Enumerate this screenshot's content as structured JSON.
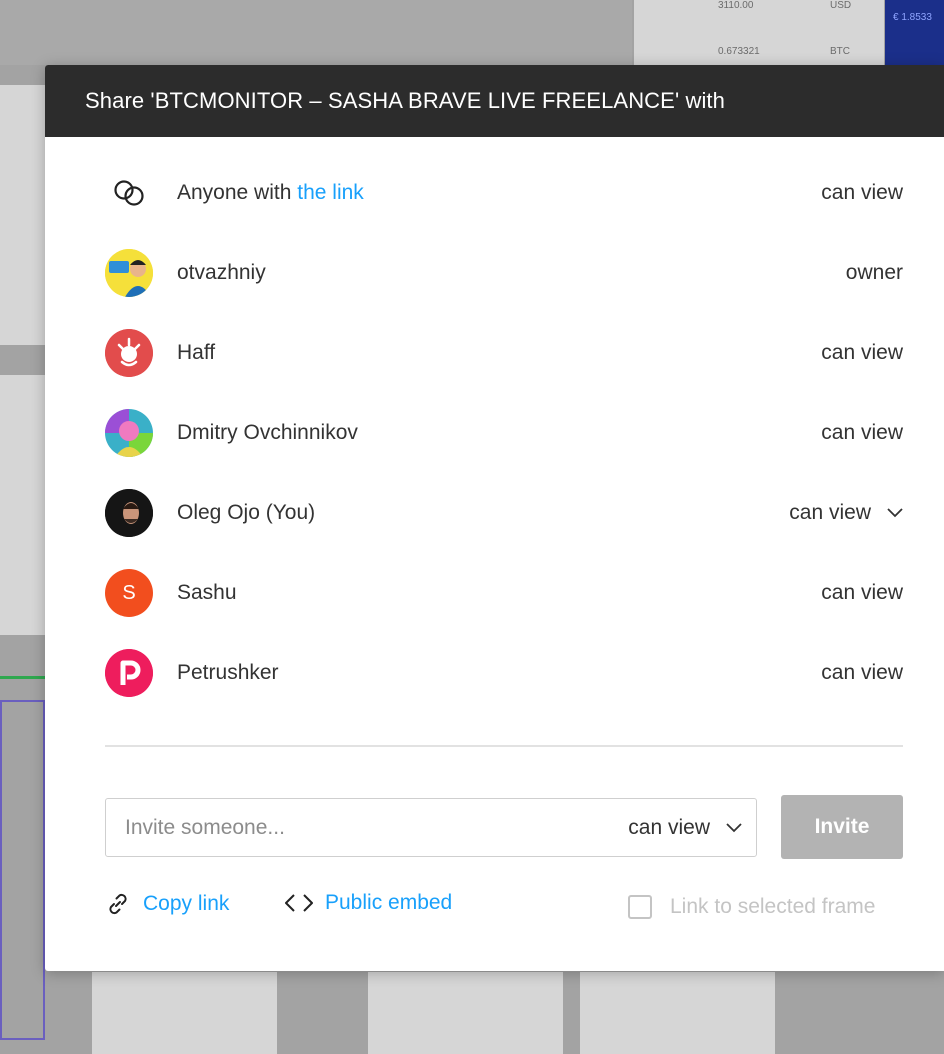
{
  "dialog": {
    "title": "Share 'BTCMONITOR – SASHA BRAVE LIVE FREELANCE' with"
  },
  "link_access": {
    "prefix": "Anyone with ",
    "link_text": "the link",
    "permission": "can view",
    "icon": "link-chain-icon"
  },
  "collaborators": [
    {
      "name": "otvazhniy",
      "permission": "owner",
      "avatar": "photo",
      "avatar_color": "#f5e03a"
    },
    {
      "name": "Haff",
      "permission": "can view",
      "avatar": "logo",
      "avatar_color": "#e24c4c"
    },
    {
      "name": "Dmitry Ovchinnikov",
      "permission": "can view",
      "avatar": "photo",
      "avatar_color": "#3ab0c8"
    },
    {
      "name": "Oleg Ojo (You)",
      "permission": "can view",
      "avatar": "photo",
      "avatar_color": "#1a1a1a",
      "has_dropdown": true
    },
    {
      "name": "Sashu",
      "permission": "can view",
      "avatar": "letter",
      "avatar_letter": "S",
      "avatar_color": "#f24e1e"
    },
    {
      "name": "Petrushker",
      "permission": "can view",
      "avatar": "logo",
      "avatar_color": "#ee1d5d"
    }
  ],
  "invite": {
    "placeholder": "Invite someone...",
    "permission": "can view",
    "button_label": "Invite"
  },
  "footer": {
    "copy_link": "Copy link",
    "public_embed": "Public embed",
    "link_to_frame": "Link to selected frame"
  },
  "background_canvas": {
    "values": [
      "3110.00",
      "USD",
      "0.673321",
      "BTC",
      "€ 1.8533"
    ]
  },
  "colors": {
    "header_bg": "#2c2c2c",
    "accent_blue": "#18a0fb",
    "invite_disabled": "#b3b3b3"
  }
}
